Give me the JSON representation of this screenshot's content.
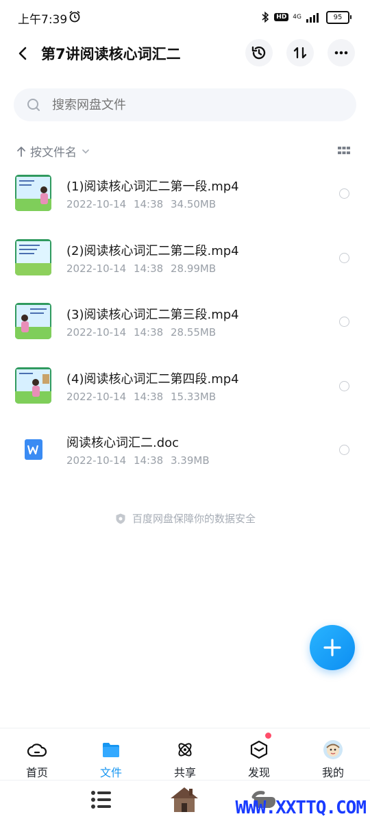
{
  "status": {
    "time": "上午7:39",
    "network": "4G",
    "hd": "HD",
    "battery": "95"
  },
  "header": {
    "title": "第7讲阅读核心词汇二"
  },
  "search": {
    "placeholder": "搜索网盘文件"
  },
  "sort": {
    "label": "按文件名"
  },
  "files": [
    {
      "name": "(1)阅读核心词汇二第一段.mp4",
      "date": "2022-10-14",
      "time": "14:38",
      "size": "34.50MB",
      "type": "video"
    },
    {
      "name": "(2)阅读核心词汇二第二段.mp4",
      "date": "2022-10-14",
      "time": "14:38",
      "size": "28.99MB",
      "type": "video"
    },
    {
      "name": "(3)阅读核心词汇二第三段.mp4",
      "date": "2022-10-14",
      "time": "14:38",
      "size": "28.55MB",
      "type": "video"
    },
    {
      "name": "(4)阅读核心词汇二第四段.mp4",
      "date": "2022-10-14",
      "time": "14:38",
      "size": "15.33MB",
      "type": "video"
    },
    {
      "name": "阅读核心词汇二.doc",
      "date": "2022-10-14",
      "time": "14:38",
      "size": "3.39MB",
      "type": "doc"
    }
  ],
  "footer_note": "百度网盘保障你的数据安全",
  "nav": [
    {
      "label": "首页",
      "icon": "home-icon"
    },
    {
      "label": "文件",
      "icon": "folder-icon"
    },
    {
      "label": "共享",
      "icon": "share-atom-icon"
    },
    {
      "label": "发现",
      "icon": "discover-cube-icon"
    },
    {
      "label": "我的",
      "icon": "avatar"
    }
  ],
  "watermark": "WWW.XXTTQ.COM",
  "colors": {
    "accent": "#1796f1",
    "badge": "#ff4d6a",
    "doc": "#3a8bf3"
  }
}
